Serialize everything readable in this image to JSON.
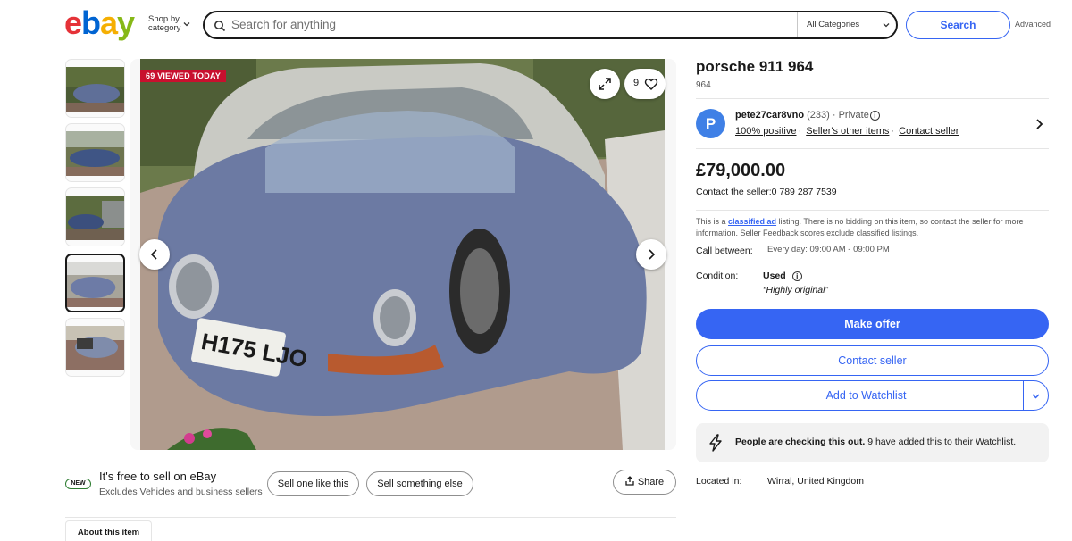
{
  "header": {
    "logo_letters": [
      "e",
      "b",
      "a",
      "y"
    ],
    "logo_colors": [
      "#e53238",
      "#0064d2",
      "#f5af02",
      "#86b817"
    ],
    "shop_by_line1": "Shop by",
    "shop_by_line2": "category",
    "search_placeholder": "Search for anything",
    "category_selected": "All Categories",
    "search_button": "Search",
    "advanced_link": "Advanced"
  },
  "gallery": {
    "thumbnail_count": 5,
    "selected_thumbnail": 4,
    "viewed_badge": "69 VIEWED TODAY",
    "watch_count": "9",
    "plate_text": "H175 LJO"
  },
  "sell_banner": {
    "new_badge": "NEW",
    "headline": "It's free to sell on eBay",
    "subtext": "Excludes Vehicles and business sellers",
    "sell_one_like_this": "Sell one like this",
    "sell_something_else": "Sell something else",
    "share": "Share"
  },
  "tabs": {
    "about": "About this item"
  },
  "listing": {
    "title": "porsche 911 964",
    "subtitle": "964",
    "seller": {
      "avatar_letter": "P",
      "username": "pete27car8vno",
      "feedback_count": "(233)",
      "type": "Private",
      "positive": "100% positive",
      "other_items": "Seller's other items",
      "contact": "Contact seller"
    },
    "price": "£79,000.00",
    "contact_phone": "Contact the seller:0 789 287 7539",
    "classified_pre": "This is a ",
    "classified_link": "classified ad",
    "classified_post": " listing. There is no bidding on this item, so contact the seller for more information. Seller Feedback scores exclude classified listings.",
    "call_between_label": "Call between:",
    "call_between_value": "Every day: 09:00 AM - 09:00 PM",
    "condition_label": "Condition:",
    "condition_value": "Used",
    "condition_note": "“Highly original”",
    "make_offer": "Make offer",
    "contact_seller_button": "Contact seller",
    "add_to_watchlist": "Add to Watchlist",
    "people_bold": "People are checking this out.",
    "people_rest": " 9 have added this to their Watchlist.",
    "located_label": "Located in:",
    "located_value": "Wirral, United Kingdom"
  },
  "colors": {
    "accent_blue": "#3665f3",
    "badge_red": "#c8102e",
    "new_badge_green": "#2e7d32"
  }
}
